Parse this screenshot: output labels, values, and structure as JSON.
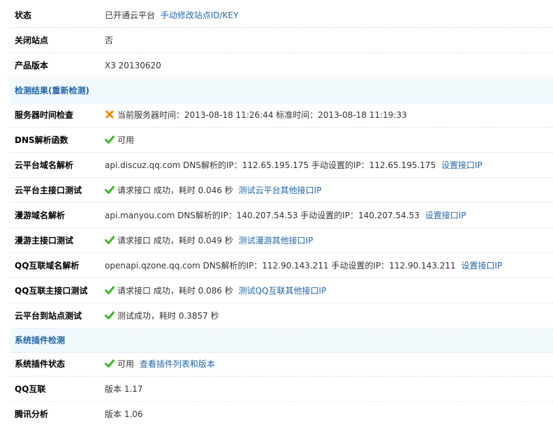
{
  "rows": {
    "status": {
      "label": "状态",
      "text": "已开通云平台",
      "link": "手动修改站点ID/KEY"
    },
    "close_site": {
      "label": "关闭站点",
      "text": "否"
    },
    "version": {
      "label": "产品版本",
      "text": "X3 20130620"
    }
  },
  "detect_section": {
    "title": "检测结果(重新检测)"
  },
  "detect": {
    "server_time": {
      "label": "服务器时间检查",
      "icon": "error-cross-icon",
      "text": "当前服务器时间：2013-08-18 11:26:44 标准时间：2013-08-18 11:19:33"
    },
    "dns_func": {
      "label": "DNS解析函数",
      "icon": "check-icon",
      "text": "可用"
    },
    "cloud_domain": {
      "label": "云平台域名解析",
      "text": "api.discuz.qq.com DNS解析的IP：112.65.195.175 手动设置的IP：112.65.195.175",
      "link": "设置接口IP"
    },
    "cloud_main": {
      "label": "云平台主接口测试",
      "icon": "check-icon",
      "text": "请求接口  成功，耗时  0.046 秒",
      "link": "测试云平台其他接口IP"
    },
    "manyou_domain": {
      "label": "漫游域名解析",
      "text": "api.manyou.com DNS解析的IP：140.207.54.53 手动设置的IP：140.207.54.53",
      "link": "设置接口IP"
    },
    "manyou_main": {
      "label": "漫游主接口测试",
      "icon": "check-icon",
      "text": "请求接口  成功，耗时  0.049 秒",
      "link": "测试漫游其他接口IP"
    },
    "qq_domain": {
      "label": "QQ互联域名解析",
      "text": "openapi.qzone.qq.com DNS解析的IP：112.90.143.211 手动设置的IP：112.90.143.211",
      "link": "设置接口IP"
    },
    "qq_main": {
      "label": "QQ互联主接口测试",
      "icon": "check-icon",
      "text": "请求接口  成功，耗时  0.086 秒",
      "link": "测试QQ互联其他接口IP"
    },
    "cloud_to_site": {
      "label": "云平台到站点测试",
      "icon": "check-icon",
      "text": "测试成功，耗时  0.3857 秒"
    }
  },
  "plugin_section": {
    "title": "系统插件检测"
  },
  "plugins": {
    "status": {
      "label": "系统插件状态",
      "icon": "check-icon",
      "text": "可用",
      "link": "查看插件列表和版本"
    },
    "qq_connect": {
      "label": "QQ互联",
      "text": "版本  1.17"
    },
    "tencent_analysis": {
      "label": "腾讯分析",
      "text": "版本  1.06"
    }
  },
  "colors": {
    "link": "#2366a8",
    "section_bg": "#f2f9fd",
    "check": "#3cb521",
    "cross": "#f08a00"
  }
}
